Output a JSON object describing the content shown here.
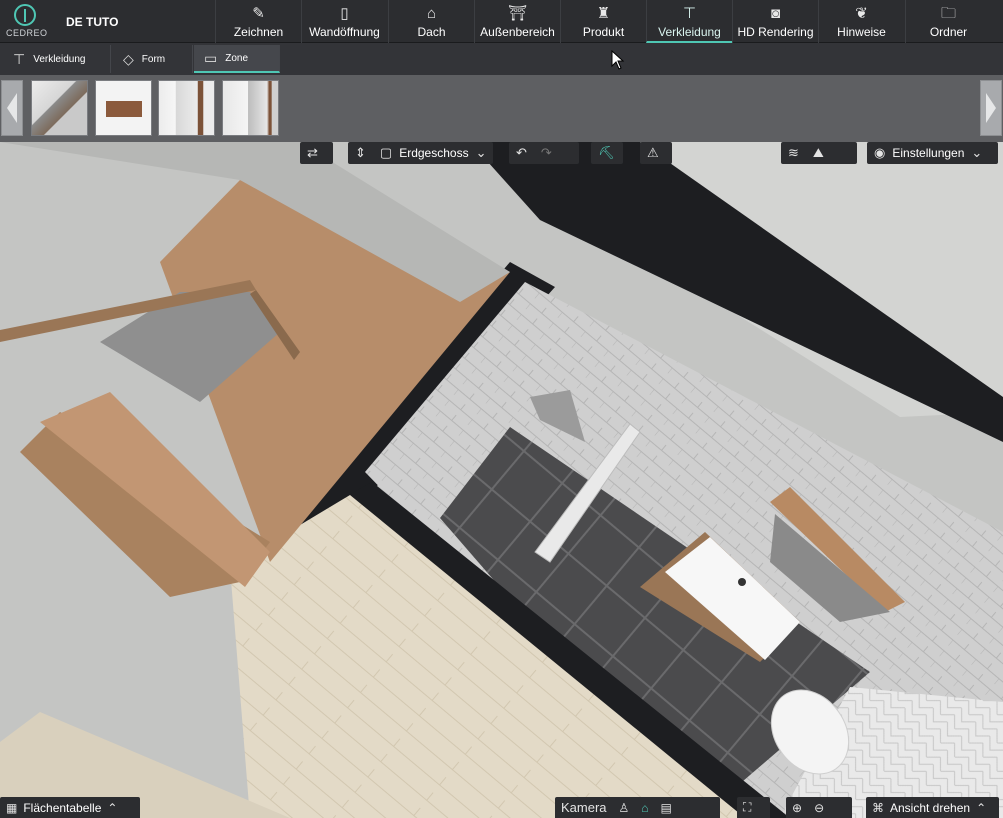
{
  "app": {
    "logo_text": "CEDREO",
    "project_name": "DE TUTO"
  },
  "nav": [
    {
      "label": "Zeichnen",
      "icon": "pencil-icon",
      "glyph": "✎"
    },
    {
      "label": "Wandöffnung",
      "icon": "door-icon",
      "glyph": "▯"
    },
    {
      "label": "Dach",
      "icon": "roof-icon",
      "glyph": "⌂"
    },
    {
      "label": "Außenbereich",
      "icon": "exterior-icon",
      "glyph": "⛩"
    },
    {
      "label": "Produkt",
      "icon": "product-icon",
      "glyph": "♜"
    },
    {
      "label": "Verkleidung",
      "icon": "paint-roller-icon",
      "glyph": "⊤",
      "active": true
    },
    {
      "label": "HD Rendering",
      "icon": "camera-icon",
      "glyph": "◙"
    },
    {
      "label": "Hinweise",
      "icon": "hints-icon",
      "glyph": "❦"
    },
    {
      "label": "Ordner",
      "icon": "folder-icon",
      "glyph": "🗀"
    }
  ],
  "subtabs": [
    {
      "label": "Verkleidung",
      "icon": "paint-roller-icon",
      "glyph": "⊤"
    },
    {
      "label": "Form",
      "icon": "shapes-icon",
      "glyph": "◇"
    },
    {
      "label": "Zone",
      "icon": "zone-icon",
      "glyph": "▭",
      "active": true
    }
  ],
  "thumbnails": [
    {
      "name": "thumbnail-zone-1"
    },
    {
      "name": "thumbnail-zone-2"
    },
    {
      "name": "thumbnail-zone-3"
    },
    {
      "name": "thumbnail-zone-4"
    }
  ],
  "viewport_toolbar": {
    "floor_label": "Erdgeschoss",
    "settings_label": "Einstellungen"
  },
  "bottom": {
    "area_table_label": "Flächentabelle",
    "camera_label": "Kamera",
    "rotate_label": "Ansicht drehen"
  },
  "colors": {
    "accent": "#4fc7b4",
    "topbar": "#2c2d30",
    "wall_dark": "#1d1e21",
    "stair_wood": "#b98e6a",
    "floor_light": "#e0d8c6",
    "tile_dark": "#4a4a4c"
  }
}
